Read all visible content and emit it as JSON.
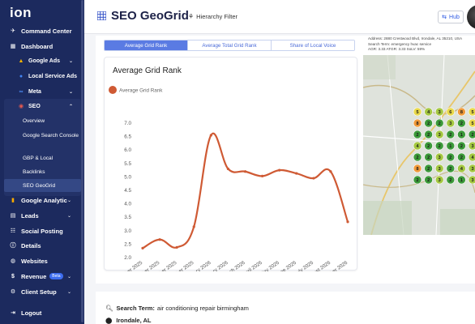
{
  "app": {
    "logo": "ion"
  },
  "sidebar": {
    "items": [
      {
        "label": "Command Center",
        "icon": "rocket-icon"
      },
      {
        "label": "Dashboard",
        "icon": "dashboard-icon"
      },
      {
        "label": "Google Ads",
        "icon": "google-ads-icon"
      },
      {
        "label": "Local Service Ads",
        "icon": "lsa-icon"
      },
      {
        "label": "Meta",
        "icon": "meta-icon"
      },
      {
        "label": "SEO",
        "icon": "seo-icon"
      },
      {
        "label": "Google Analytic",
        "icon": "analytics-icon"
      },
      {
        "label": "Leads",
        "icon": "leads-icon"
      },
      {
        "label": "Social Posting",
        "icon": "social-icon"
      },
      {
        "label": "Details",
        "icon": "info-icon"
      },
      {
        "label": "Websites",
        "icon": "globe-icon"
      },
      {
        "label": "Revenue",
        "icon": "revenue-icon",
        "badge": "Beta"
      },
      {
        "label": "Client Setup",
        "icon": "setup-icon"
      },
      {
        "label": "Logout",
        "icon": "logout-icon"
      }
    ],
    "seo_children": [
      "Overview",
      "Google Search Console",
      "GBP & Local",
      "Backlinks",
      "SEO GeoGrid"
    ]
  },
  "header": {
    "title": "SEO GeoGrid",
    "filter_label": "Hierarchy Filter",
    "hub_label": "Hub"
  },
  "tabs": [
    "Average Grid Rank",
    "Average Total Grid Rank",
    "Share of Local Voice"
  ],
  "map_info": {
    "address": "Address: 2880 Crestwood Blvd, Irondale, AL 35210, USA",
    "search_term": "Search Term: emergency hvac service",
    "stats": "AGR: 3.33   ATGR: 3.33   SoLV: 59%"
  },
  "map_pins": [
    [
      "5",
      "4",
      "3",
      "6",
      "8",
      "5"
    ],
    [
      "8",
      "2",
      "2",
      "3",
      "2",
      "5"
    ],
    [
      "2",
      "2",
      "3",
      "2",
      "1",
      "2"
    ],
    [
      "4",
      "2",
      "2",
      "1",
      "2",
      "3"
    ],
    [
      "2",
      "2",
      "3",
      "2",
      "2",
      "4"
    ],
    [
      "8",
      "2",
      "3",
      "2",
      "4",
      "3"
    ],
    [
      "2",
      "2",
      "3",
      "2",
      "1",
      "3"
    ]
  ],
  "lower": {
    "search_term_label": "Search Term:",
    "search_term_value": "air conditioning repair birmingham",
    "location": "Irondale, AL"
  },
  "colors": {
    "line": "#cf5a34",
    "sidebar": "#1c2a5e",
    "tab_active": "#5a7be3"
  },
  "chart_data": {
    "type": "line",
    "title": "Average Grid Rank",
    "categories": [
      "September 2025",
      "October 2025",
      "November 2025",
      "December 2025",
      "January 2026",
      "February 2026",
      "March 2026",
      "April 2026",
      "May 2026",
      "June 2026",
      "July 2026",
      "August 2026",
      "September 2026"
    ],
    "series": [
      {
        "name": "Average Grid Rank",
        "values": [
          2.35,
          2.67,
          2.38,
          3.15,
          6.55,
          5.3,
          5.2,
          5.03,
          5.25,
          5.13,
          4.95,
          5.2,
          3.33
        ]
      }
    ],
    "yticks": [
      "2.0",
      "2.5",
      "3.0",
      "3.5",
      "4.0",
      "4.5",
      "5.0",
      "5.5",
      "6.0",
      "6.5",
      "7.0"
    ],
    "ylim": [
      2,
      7
    ],
    "legend": "top-left"
  }
}
